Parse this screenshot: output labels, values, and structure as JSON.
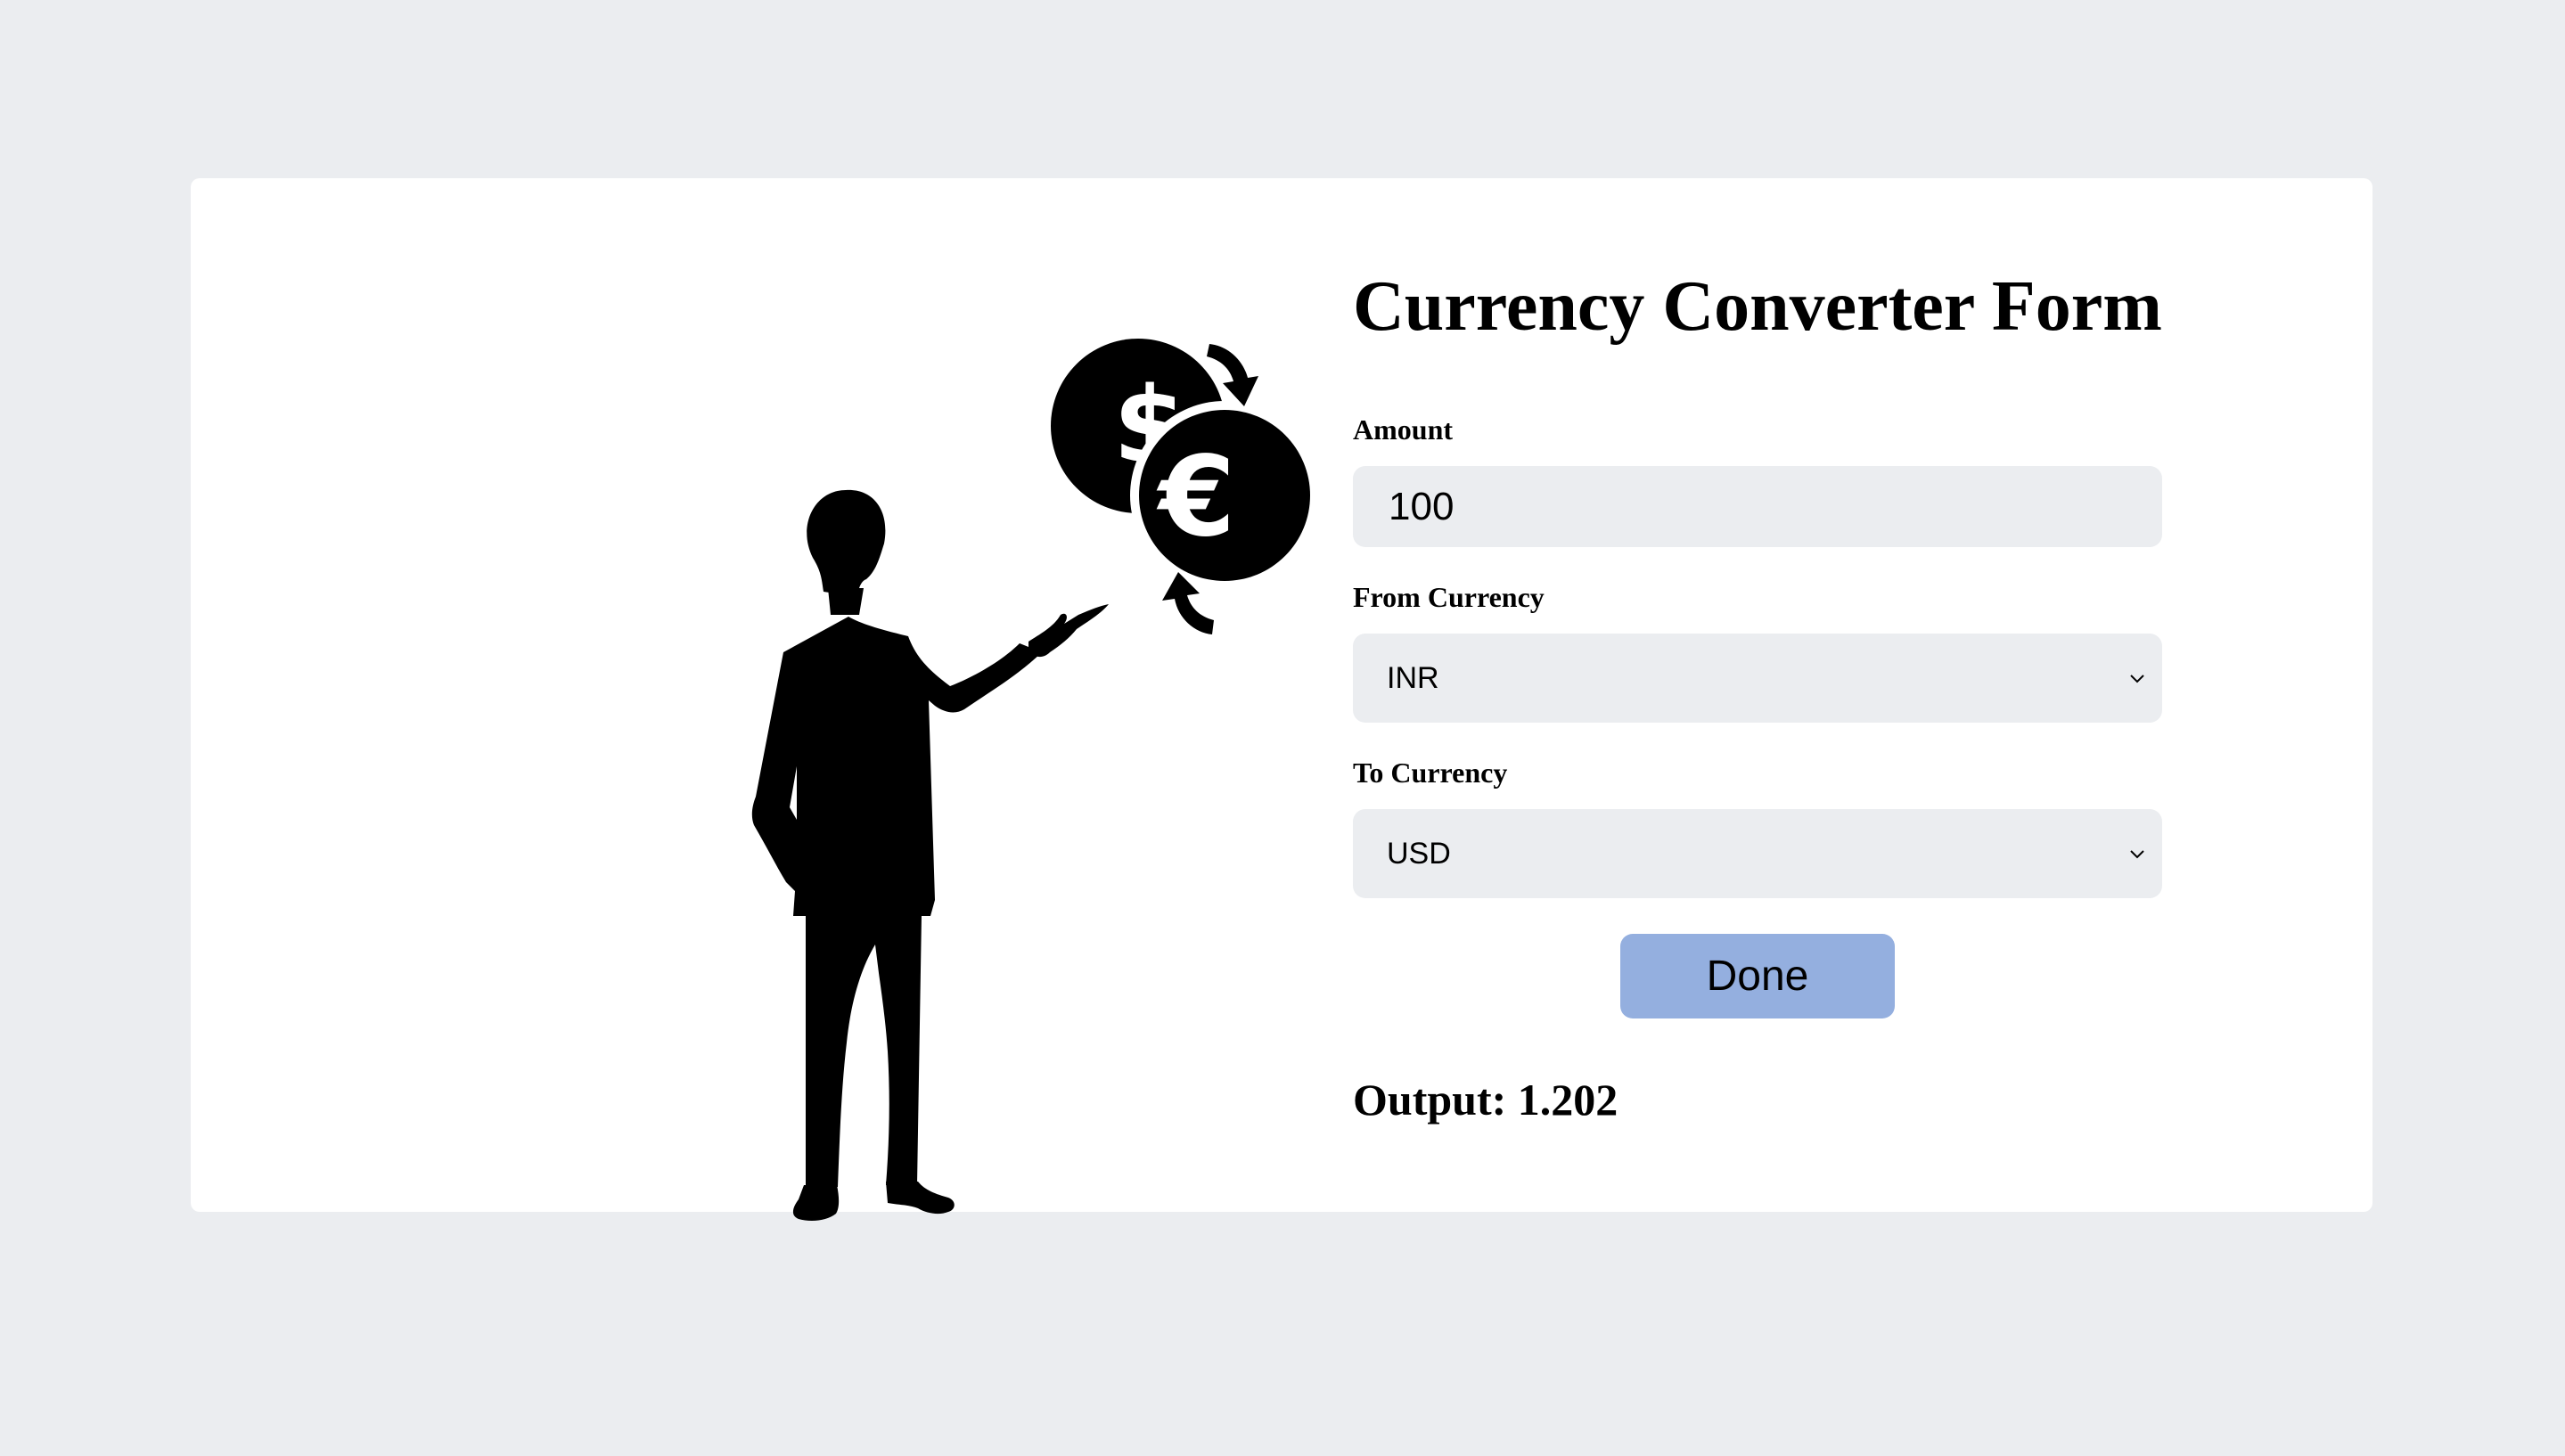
{
  "form": {
    "title": "Currency Converter Form",
    "amount": {
      "label": "Amount",
      "value": "100"
    },
    "from_currency": {
      "label": "From Currency",
      "selected": "INR"
    },
    "to_currency": {
      "label": "To Currency",
      "selected": "USD"
    },
    "submit_label": "Done",
    "output": {
      "label": "Output:",
      "value": "1.202"
    }
  },
  "illustration": {
    "subject": "businessman-pointing-at-currency-exchange-icon",
    "icons": [
      "dollar-coin-icon",
      "euro-coin-icon",
      "exchange-arrows-icon"
    ]
  },
  "colors": {
    "page_background": "#ebedf0",
    "card_background": "#ffffff",
    "field_background": "#ebedf0",
    "button_background": "#94afdf",
    "text": "#000000"
  }
}
